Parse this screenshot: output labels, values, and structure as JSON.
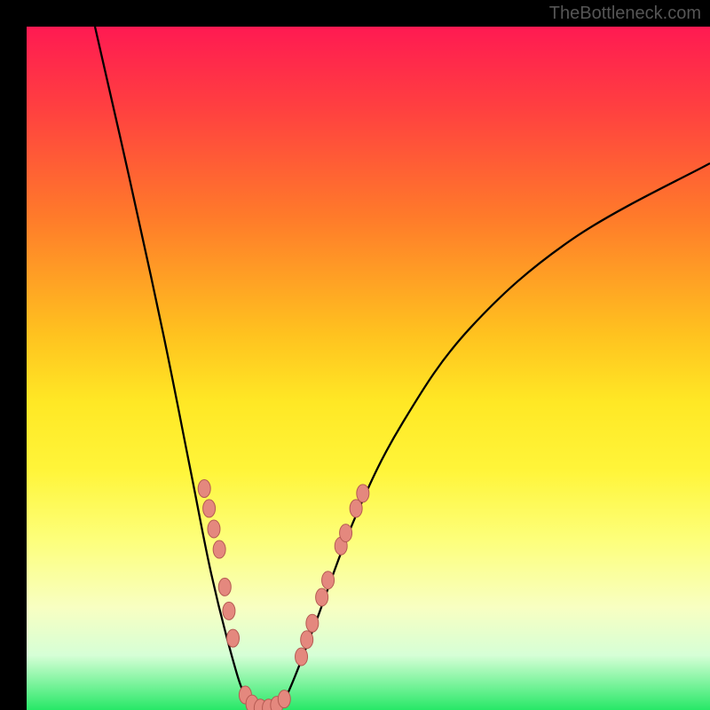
{
  "watermark": "TheBottleneck.com",
  "chart_data": {
    "type": "line",
    "title": "",
    "xlabel": "",
    "ylabel": "",
    "xlim": [
      0,
      100
    ],
    "ylim": [
      0,
      100
    ],
    "series": [
      {
        "name": "curve",
        "points": [
          {
            "x": 10,
            "y": 100
          },
          {
            "x": 15,
            "y": 78
          },
          {
            "x": 20,
            "y": 55
          },
          {
            "x": 24,
            "y": 35
          },
          {
            "x": 27,
            "y": 20
          },
          {
            "x": 30,
            "y": 8
          },
          {
            "x": 32,
            "y": 2
          },
          {
            "x": 34,
            "y": 0
          },
          {
            "x": 36,
            "y": 0
          },
          {
            "x": 38,
            "y": 2
          },
          {
            "x": 42,
            "y": 12
          },
          {
            "x": 48,
            "y": 28
          },
          {
            "x": 55,
            "y": 42
          },
          {
            "x": 65,
            "y": 56
          },
          {
            "x": 80,
            "y": 69
          },
          {
            "x": 100,
            "y": 80
          }
        ]
      }
    ],
    "markers": [
      {
        "x": 26.7,
        "y": 29.5
      },
      {
        "x": 27.4,
        "y": 26.5
      },
      {
        "x": 28.2,
        "y": 23.5
      },
      {
        "x": 26.0,
        "y": 32.4
      },
      {
        "x": 29.0,
        "y": 18.0
      },
      {
        "x": 29.6,
        "y": 14.5
      },
      {
        "x": 30.2,
        "y": 10.5
      },
      {
        "x": 32.0,
        "y": 2.2
      },
      {
        "x": 33.0,
        "y": 0.9
      },
      {
        "x": 34.2,
        "y": 0.3
      },
      {
        "x": 35.4,
        "y": 0.3
      },
      {
        "x": 36.6,
        "y": 0.7
      },
      {
        "x": 37.7,
        "y": 1.6
      },
      {
        "x": 40.2,
        "y": 7.8
      },
      {
        "x": 41.0,
        "y": 10.3
      },
      {
        "x": 41.8,
        "y": 12.7
      },
      {
        "x": 43.2,
        "y": 16.5
      },
      {
        "x": 44.1,
        "y": 19.0
      },
      {
        "x": 46.0,
        "y": 24.0
      },
      {
        "x": 46.7,
        "y": 25.9
      },
      {
        "x": 48.2,
        "y": 29.5
      },
      {
        "x": 49.2,
        "y": 31.7
      }
    ],
    "marker_style": {
      "fill": "#e4887e",
      "stroke": "#b55a52",
      "rx": 7,
      "ry": 10
    }
  }
}
